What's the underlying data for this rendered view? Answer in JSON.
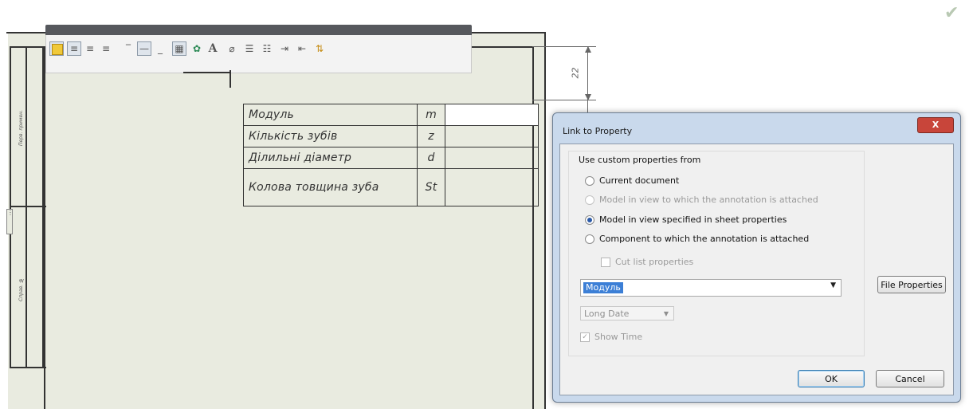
{
  "toolbar": {
    "icons": [
      "layer-icon",
      "align-left-icon",
      "align-center-icon",
      "align-right-icon",
      "line-top-icon",
      "line-middle-icon",
      "line-bottom-icon",
      "table-icon",
      "link-property-icon",
      "font-icon",
      "symbol-icon",
      "bullets-icon",
      "numbering-icon",
      "indent-increase-icon",
      "indent-decrease-icon",
      "stack-icon"
    ],
    "font_glyph": "A"
  },
  "stamp": {
    "label_top": "Перв. примен.",
    "label_bottom": "Справ. №"
  },
  "table": {
    "rows": [
      {
        "name": "Модуль",
        "symbol": "m",
        "value": ""
      },
      {
        "name": "Кількість зубів",
        "symbol": "z",
        "value": ""
      },
      {
        "name": "Ділильні діаметр",
        "symbol": "d",
        "value": ""
      },
      {
        "name": "Колова товщина зуба",
        "symbol": "St",
        "value": ""
      }
    ]
  },
  "dimension": {
    "value": "22"
  },
  "dialog": {
    "title": "Link to Property",
    "close_label": "X",
    "group_title": "Use custom properties from",
    "options": [
      {
        "label": "Current document",
        "selected": false,
        "enabled": true
      },
      {
        "label": "Model in view to which the annotation is attached",
        "selected": false,
        "enabled": false
      },
      {
        "label": "Model in view specified in sheet properties",
        "selected": true,
        "enabled": true
      },
      {
        "label": "Component to which the annotation is attached",
        "selected": false,
        "enabled": true
      }
    ],
    "cutlist_label": "Cut list properties",
    "property_value": "Модуль",
    "file_properties_label": "File Properties",
    "date_format": "Long Date",
    "show_time_label": "Show Time",
    "ok_label": "OK",
    "cancel_label": "Cancel"
  },
  "colors": {
    "sheet": "#e9ebe0",
    "dialog_frame": "#c9d9ec",
    "selection": "#3c7fd6",
    "close_button": "#c8453a"
  }
}
